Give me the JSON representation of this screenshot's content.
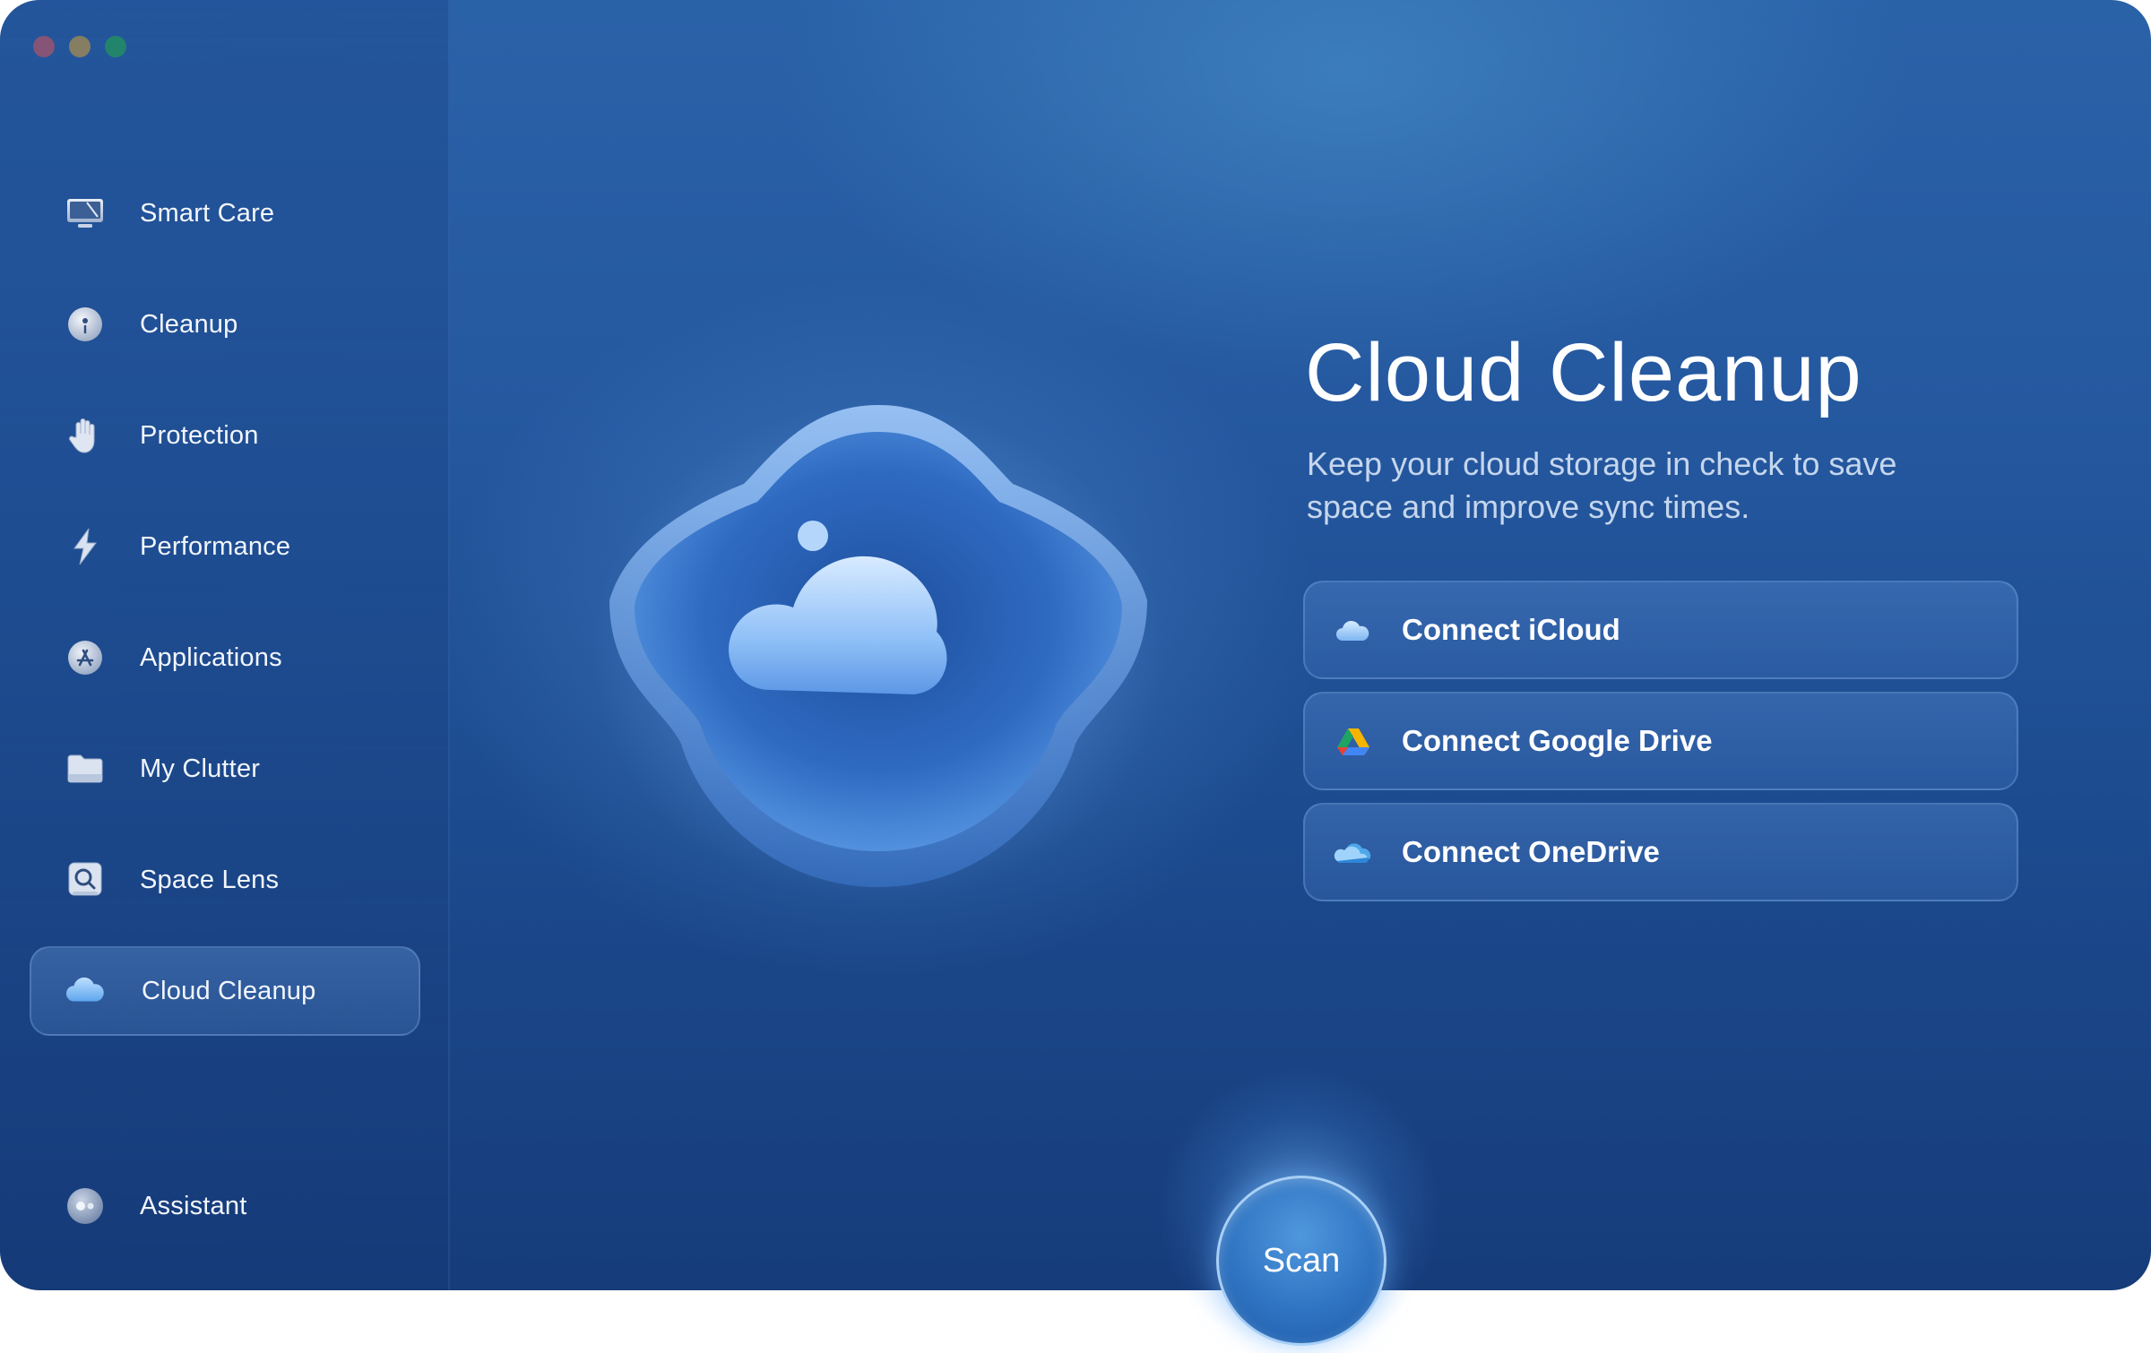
{
  "window": {
    "controls": [
      "close",
      "minimize",
      "zoom"
    ]
  },
  "sidebar": {
    "items": [
      {
        "label": "Smart Care",
        "icon": "monitor-icon"
      },
      {
        "label": "Cleanup",
        "icon": "disc-icon"
      },
      {
        "label": "Protection",
        "icon": "hand-icon"
      },
      {
        "label": "Performance",
        "icon": "lightning-icon"
      },
      {
        "label": "Applications",
        "icon": "app-store-icon"
      },
      {
        "label": "My Clutter",
        "icon": "folder-icon"
      },
      {
        "label": "Space Lens",
        "icon": "magnifier-icon"
      },
      {
        "label": "Cloud Cleanup",
        "icon": "cloud-icon",
        "active": true
      }
    ],
    "assistant": {
      "label": "Assistant",
      "icon": "assistant-icon"
    }
  },
  "main": {
    "title": "Cloud Cleanup",
    "subtitle": "Keep your cloud storage in check to save space and improve sync times.",
    "connect_buttons": [
      {
        "label": "Connect iCloud",
        "icon": "icloud-icon"
      },
      {
        "label": "Connect Google Drive",
        "icon": "google-drive-icon"
      },
      {
        "label": "Connect OneDrive",
        "icon": "onedrive-icon"
      }
    ],
    "scan_label": "Scan"
  },
  "colors": {
    "accent": "#2f74c2",
    "background_top": "#2a62a8",
    "background_bottom": "#163c7a",
    "traffic_red": "#ff5f57",
    "traffic_yellow": "#febc2e",
    "traffic_green": "#28c840"
  }
}
